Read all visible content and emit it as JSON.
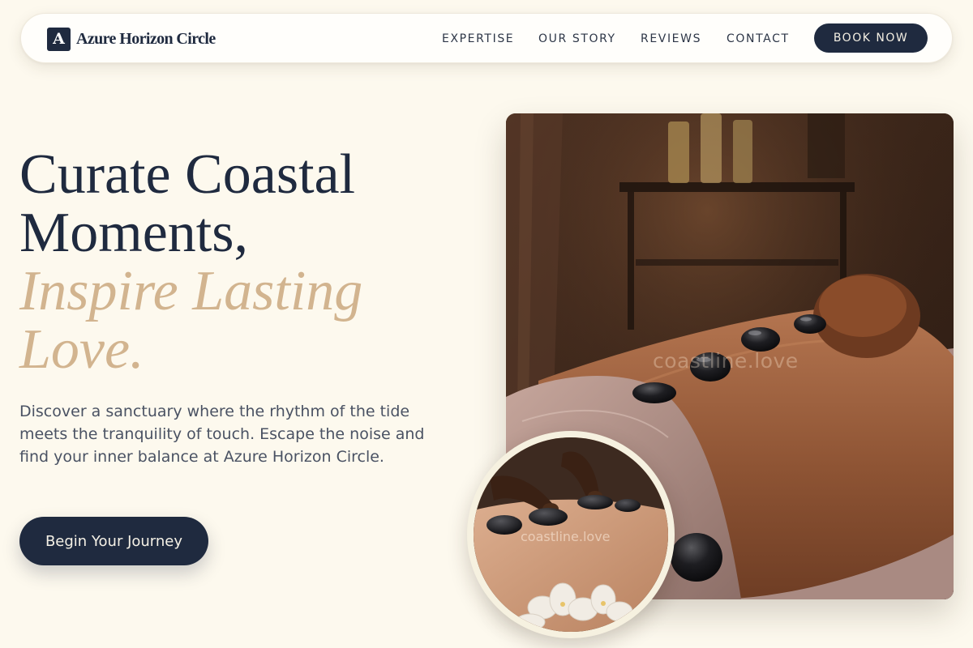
{
  "brand": {
    "mark": "A",
    "name": "Azure Horizon Circle"
  },
  "nav": {
    "links": [
      "EXPERTISE",
      "OUR STORY",
      "REVIEWS",
      "CONTACT"
    ],
    "cta_label": "BOOK NOW"
  },
  "hero": {
    "headline_line1": "Curate Coastal",
    "headline_line2": "Moments,",
    "accent_line1": "Inspire Lasting",
    "accent_line2": "Love.",
    "intro": "Discover a sanctuary where the rhythm of the tide meets the tranquility of touch. Escape the noise and find your inner balance at Azure Horizon Circle.",
    "cta_label": "Begin Your Journey"
  },
  "images": {
    "main_watermark": "coastline.love",
    "inset_watermark": "coastline.love"
  },
  "colors": {
    "background": "#fdf9ee",
    "navy": "#1f2a3f",
    "accent_gold": "#d2b48f"
  }
}
